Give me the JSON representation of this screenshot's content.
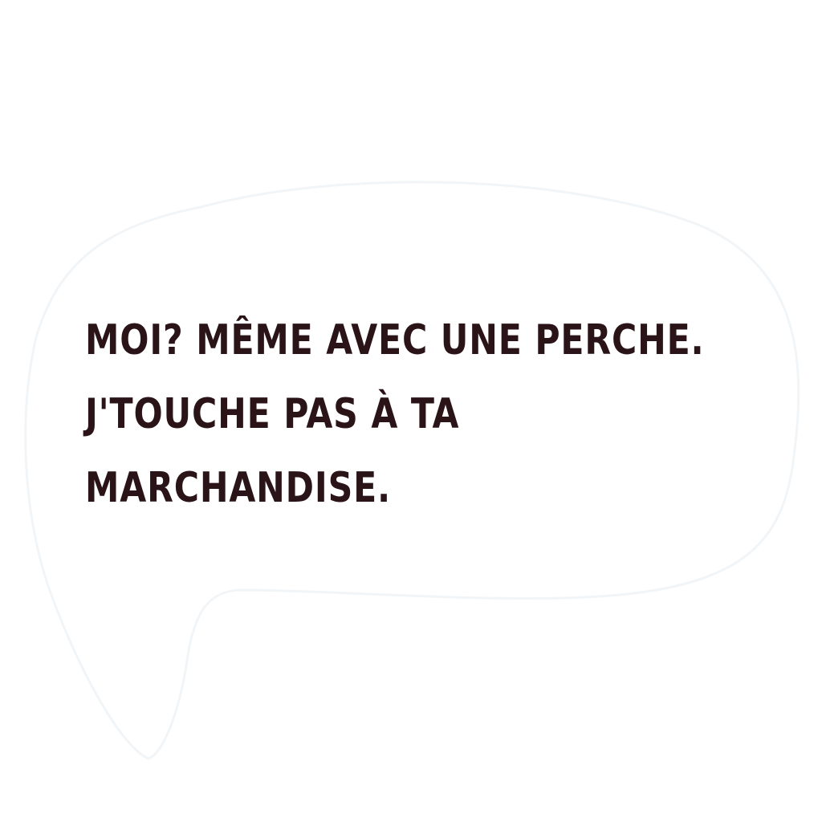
{
  "bubble": {
    "lines": [
      "MOI? MÊME AVEC UNE PERCHE.",
      "J'TOUCHE PAS À TA",
      "MARCHANDISE."
    ],
    "text_color": "#2a1418",
    "fill_color": "#ffffff",
    "outline_color": "#f1f5f8"
  }
}
